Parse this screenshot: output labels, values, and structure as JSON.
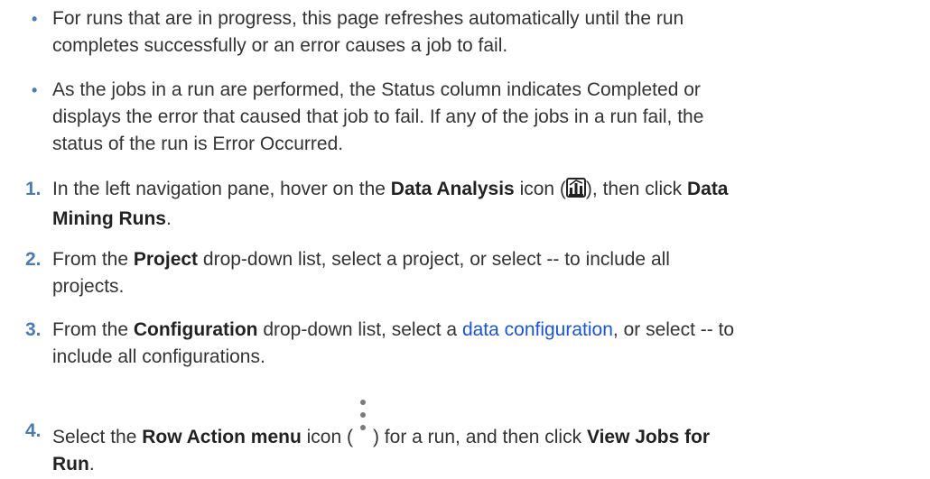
{
  "bullets": [
    {
      "marker": "•",
      "line1": "For runs that are in progress, this page refreshes automatically until the run",
      "line2": "completes successfully or an error causes a job to fail."
    },
    {
      "marker": "•",
      "line1": "As the jobs in a run are performed, the Status column indicates Completed or",
      "line2": "displays the error that caused that job to fail. If any of the jobs in a run fail, the",
      "line3": "status of the run is Error Occurred."
    }
  ],
  "steps": [
    {
      "number": "1.",
      "pre": "In the left navigation pane, hover on the ",
      "bold1": "Data Analysis",
      "mid": " icon (",
      "icon": "data-analysis-icon",
      "post": "), then click ",
      "bold2a": "Data",
      "bold2b": "Mining Runs",
      "end": "."
    },
    {
      "number": "2.",
      "pre": "From the ",
      "bold": "Project",
      "post1": " drop-down list, select a project, or select -- to include all",
      "line2": "projects."
    },
    {
      "number": "3.",
      "pre": "From the ",
      "bold": "Configuration",
      "mid": " drop-down list, select a ",
      "link": "data configuration",
      "post1": ", or select -- to",
      "line2": "include all configurations."
    },
    {
      "number": "4.",
      "pre": "Select the ",
      "bold1": "Row Action menu",
      "mid": " icon (",
      "icon": "kebab-menu-icon",
      "post": ") for a run, and then click ",
      "bold2a": "View Jobs for",
      "bold2b": "Run",
      "end": "."
    }
  ],
  "colors": {
    "marker": "#4a7bb7",
    "link": "#1a55d6",
    "text": "#333333"
  }
}
